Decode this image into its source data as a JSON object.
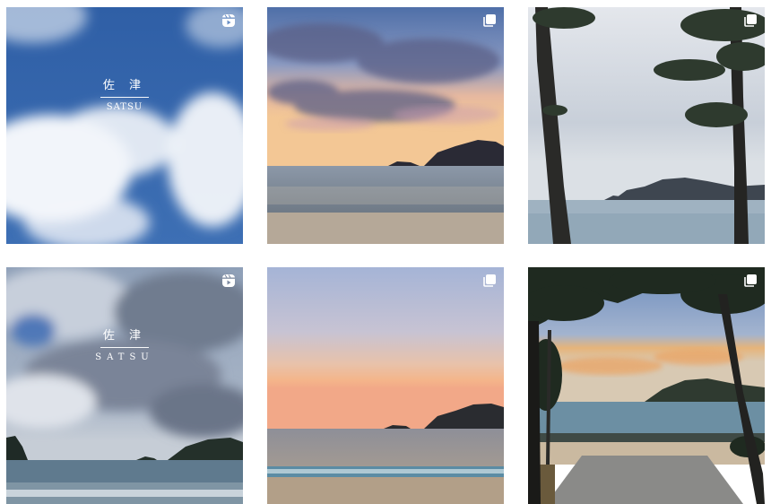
{
  "posts": [
    {
      "type": "reel",
      "badge_icon": "reel-icon",
      "overlay_jp": "佐 津",
      "overlay_en": "SATSU"
    },
    {
      "type": "carousel",
      "badge_icon": "carousel-icon"
    },
    {
      "type": "carousel",
      "badge_icon": "carousel-icon"
    },
    {
      "type": "reel",
      "badge_icon": "reel-icon",
      "overlay_jp": "佐 津",
      "overlay_en": "SATSU"
    },
    {
      "type": "carousel",
      "badge_icon": "carousel-icon"
    },
    {
      "type": "carousel",
      "badge_icon": "carousel-icon"
    }
  ],
  "colors": {
    "background": "#ffffff",
    "badge": "#ffffff"
  }
}
